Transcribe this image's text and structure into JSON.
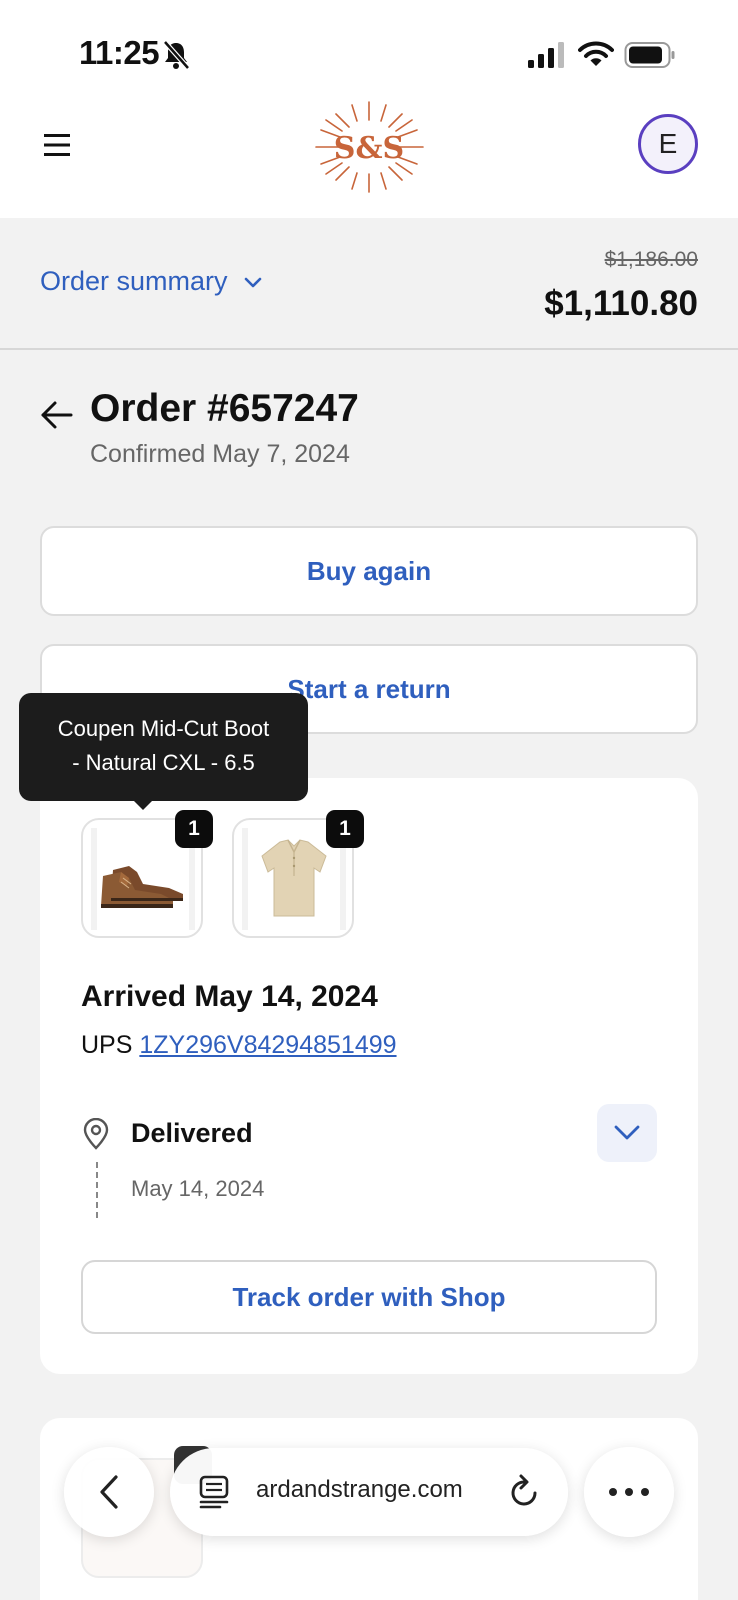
{
  "status_bar": {
    "time": "11:25",
    "icons": [
      "bell-slash-icon",
      "signal-icon",
      "wifi-icon",
      "battery-icon"
    ]
  },
  "header": {
    "menu_icon": "hamburger-icon",
    "logo_icon": "sunburst-logo",
    "logo_text": "S&S",
    "avatar_initial": "E"
  },
  "summary": {
    "label": "Order summary",
    "original_price": "$1,186.00",
    "total_price": "$1,110.80"
  },
  "order": {
    "title": "Order #657247",
    "confirmed": "Confirmed May 7, 2024"
  },
  "actions": {
    "buy_again": "Buy again",
    "start_return": "Start a return"
  },
  "tooltip": {
    "line1": "Coupen Mid-Cut Boot",
    "line2": "- Natural CXL - 6.5"
  },
  "shipment": {
    "items": [
      {
        "icon": "boot-icon",
        "quantity": "1"
      },
      {
        "icon": "shirt-icon",
        "quantity": "1"
      }
    ],
    "arrived": "Arrived May 14, 2024",
    "carrier": "UPS",
    "tracking_number": "1ZY296V84294851499",
    "status": "Delivered",
    "status_date": "May 14, 2024",
    "track_button": "Track order with Shop"
  },
  "browser": {
    "url": "ardandstrange.com"
  },
  "colors": {
    "accent": "#2f5fbe",
    "avatar_ring": "#5a3fc0",
    "logo": "#c8653a"
  }
}
